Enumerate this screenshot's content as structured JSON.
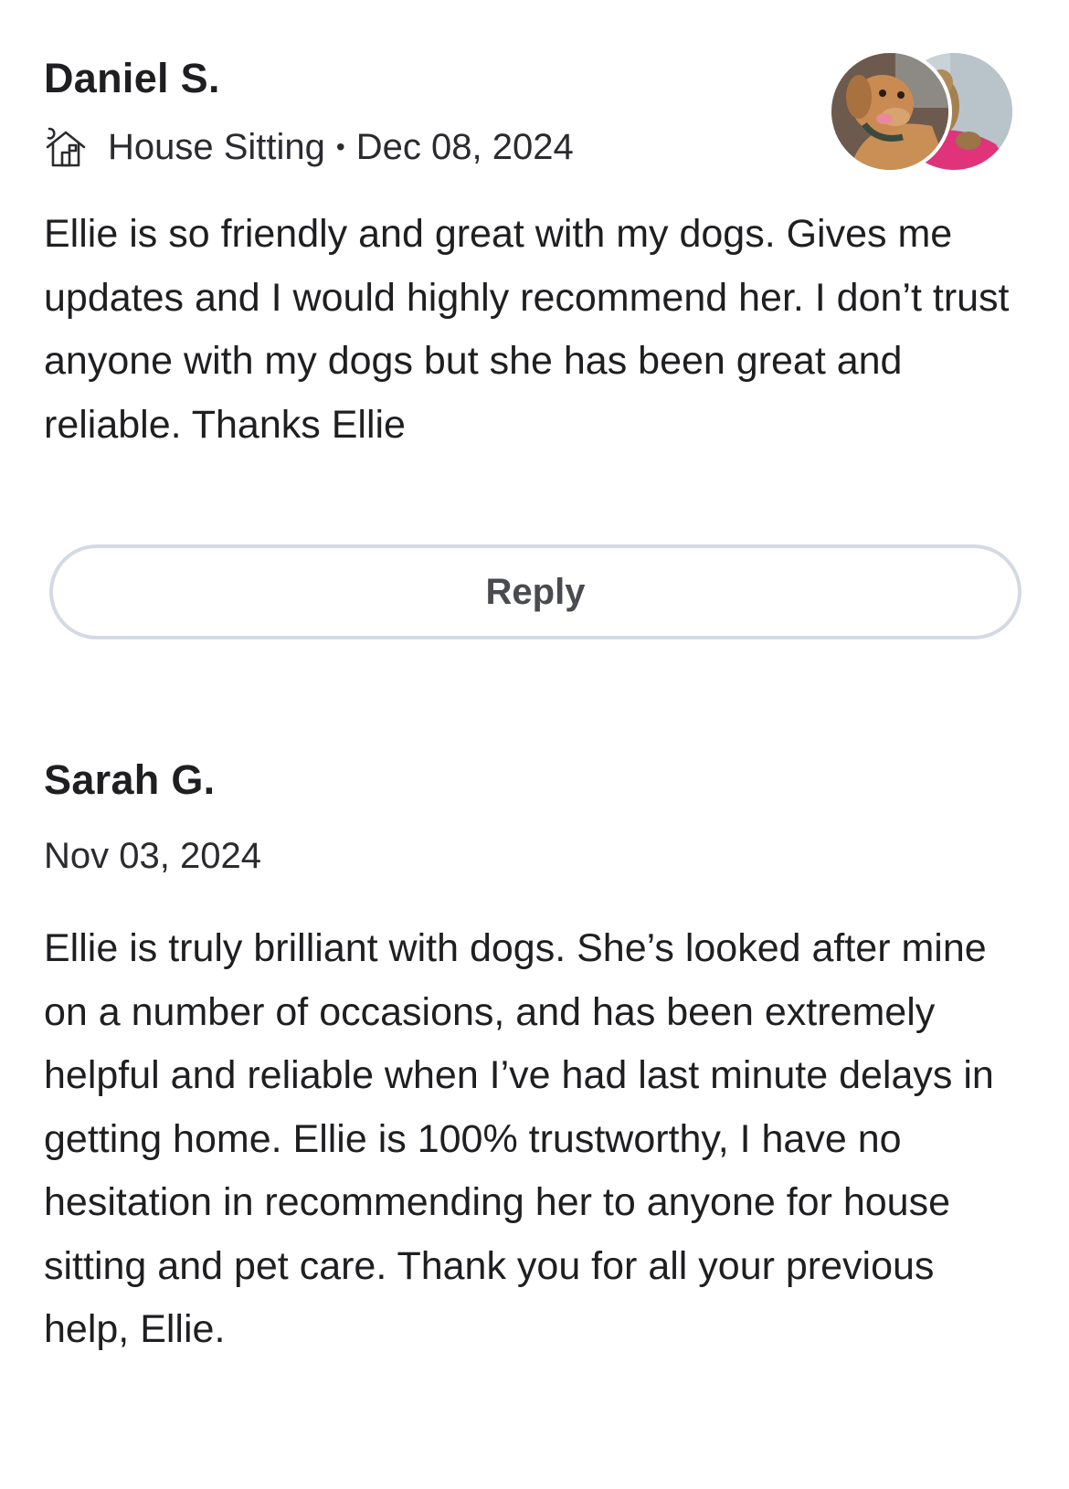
{
  "reviews": [
    {
      "reviewer": "Daniel S.",
      "service": "House Sitting",
      "service_icon": "house-sitting-icon",
      "separator": "•",
      "date": "Dec 08, 2024",
      "text": "Ellie is so friendly and great with my dogs. Gives me updates and I would highly recommend her. I don’t trust anyone with my dogs but she has been great and reliable. Thanks Ellie",
      "reply_label": "Reply",
      "avatars": [
        "dog-photo-avatar",
        "dog-photo-avatar-secondary"
      ]
    },
    {
      "reviewer": "Sarah G.",
      "date": "Nov 03, 2024",
      "text": "Ellie is truly brilliant with dogs. She’s looked after mine on a number of occasions, and has been extremely helpful and reliable when I’ve had last minute delays in getting home. Ellie is 100% trustworthy, I have no hesitation in recommending her to anyone for house sitting and pet care. Thank you for all your previous help, Ellie."
    }
  ],
  "colors": {
    "text": "#1f1f22",
    "reply_border": "#d3dae3",
    "reply_text": "#4a4b50"
  }
}
